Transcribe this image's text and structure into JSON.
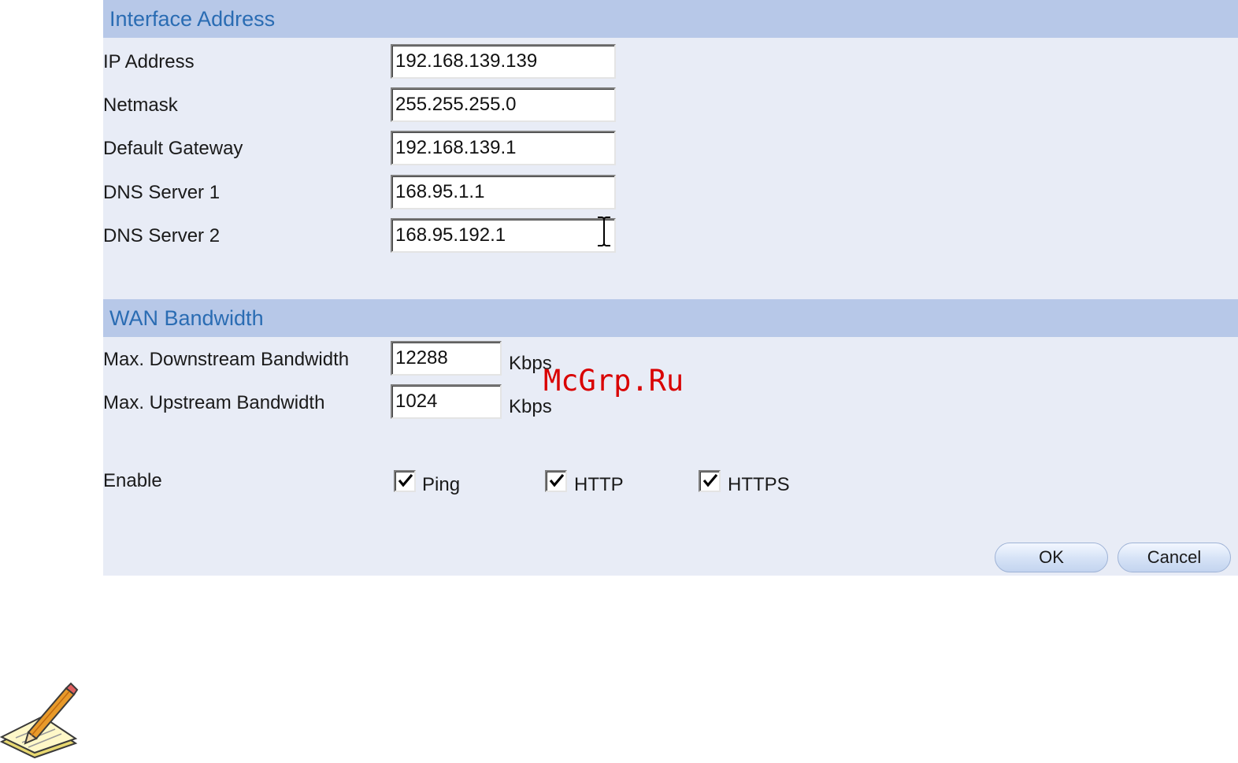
{
  "sections": {
    "interface_address": {
      "title": "Interface Address",
      "fields": [
        {
          "label": "IP Address",
          "value": "192.168.139.139"
        },
        {
          "label": "Netmask",
          "value": "255.255.255.0"
        },
        {
          "label": "Default Gateway",
          "value": "192.168.139.1"
        },
        {
          "label": "DNS Server 1",
          "value": "168.95.1.1"
        },
        {
          "label": "DNS Server 2",
          "value": "168.95.192.1"
        }
      ]
    },
    "wan_bandwidth": {
      "title": "WAN Bandwidth",
      "fields": [
        {
          "label": "Max. Downstream Bandwidth",
          "value": "12288",
          "unit": "Kbps"
        },
        {
          "label": "Max. Upstream Bandwidth",
          "value": "1024",
          "unit": "Kbps"
        }
      ]
    }
  },
  "enable": {
    "label": "Enable",
    "options": [
      {
        "label": "Ping",
        "checked": true
      },
      {
        "label": "HTTP",
        "checked": true
      },
      {
        "label": "HTTPS",
        "checked": true
      }
    ]
  },
  "buttons": {
    "ok": "OK",
    "cancel": "Cancel"
  },
  "watermark": "McGrp.Ru",
  "colors": {
    "panel_bg": "#e8ecf6",
    "header_bg": "#b7c8e8",
    "header_text": "#2a6cb3",
    "watermark": "#d90000"
  },
  "icons": [
    "note-pencil-icon",
    "text-cursor-icon",
    "checkmark-icon"
  ]
}
